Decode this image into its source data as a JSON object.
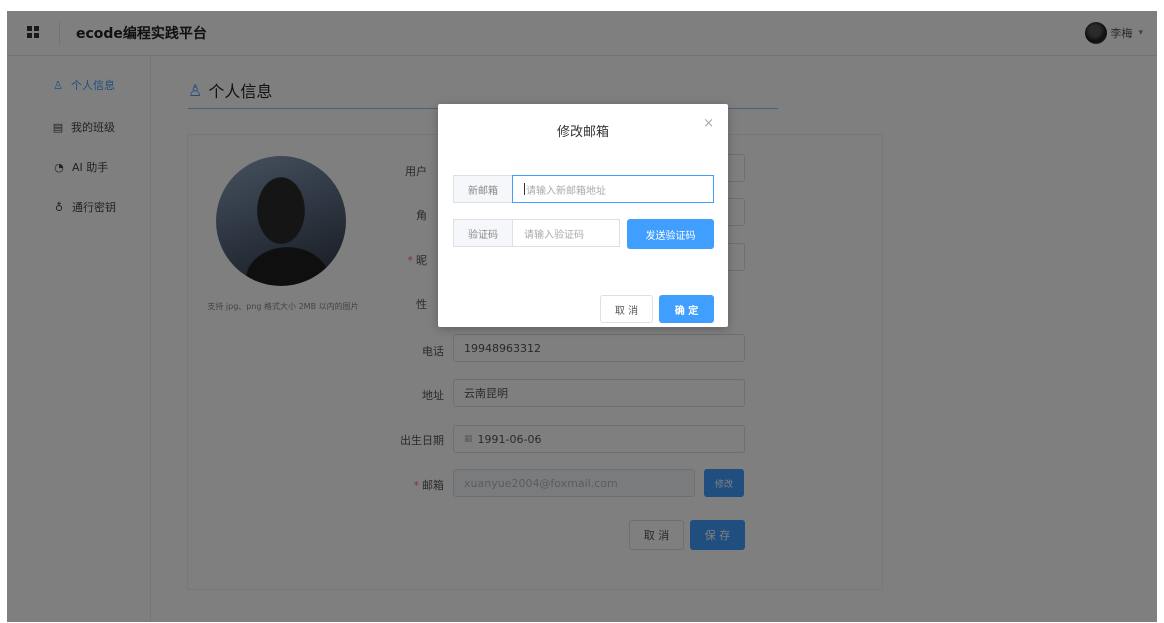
{
  "header": {
    "brand": "ecode编程实践平台",
    "user_name": "李梅",
    "caret": "▾"
  },
  "sidebar": {
    "items": [
      {
        "label": "个人信息",
        "icon": "user-icon",
        "glyph": "♙",
        "active": true
      },
      {
        "label": "我的班级",
        "icon": "document-icon",
        "glyph": "▤"
      },
      {
        "label": "AI 助手",
        "icon": "chat-icon",
        "glyph": "◔"
      },
      {
        "label": "通行密钥",
        "icon": "key-icon",
        "glyph": "♁"
      }
    ]
  },
  "page": {
    "title": "个人信息",
    "title_glyph": "♙"
  },
  "profile": {
    "photo_hint": "支持 jpg、png 格式大小 2MB 以内的图片",
    "labels": {
      "username": "用户",
      "role": "角",
      "nickname": "昵",
      "gender": "性",
      "phone": "电话",
      "address": "地址",
      "birthday": "出生日期",
      "email": "邮箱"
    },
    "required_mark": "*",
    "phone": "19948963312",
    "address": "云南昆明",
    "birthday": "1991-06-06",
    "calendar_glyph": "▦",
    "email": "xuanyue2004@foxmail.com",
    "modify_label": "修改",
    "cancel_label": "取 消",
    "save_label": "保 存"
  },
  "dialog": {
    "title": "修改邮箱",
    "close_glyph": "×",
    "new_email_label": "新邮箱",
    "new_email_placeholder": "请输入新邮箱地址",
    "code_label": "验证码",
    "code_placeholder": "请输入验证码",
    "send_code_label": "发送验证码",
    "cancel_label": "取 消",
    "confirm_label": "确 定"
  },
  "colors": {
    "accent": "#409eff",
    "required": "#f56c6c",
    "overlay": "rgba(0,0,0,0.5)"
  }
}
